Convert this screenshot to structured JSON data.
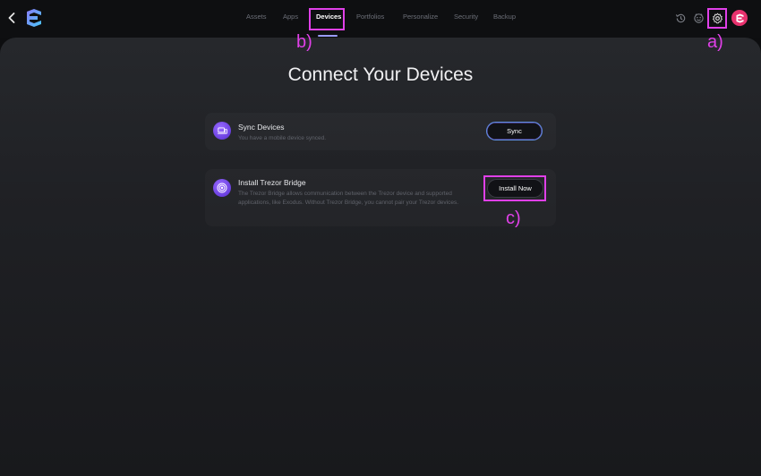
{
  "header": {
    "tabs": [
      {
        "label": "Assets"
      },
      {
        "label": "Apps"
      },
      {
        "label": "Devices",
        "active": true
      },
      {
        "label": "Portfolios"
      },
      {
        "label": "Personalize"
      },
      {
        "label": "Security"
      },
      {
        "label": "Backup"
      }
    ],
    "icons": [
      "back-icon",
      "exodus-logo",
      "history-icon",
      "smiley-icon",
      "gear-icon",
      "avatar"
    ]
  },
  "main": {
    "title": "Connect Your Devices",
    "cards": [
      {
        "title": "Sync Devices",
        "description": "You have a mobile device synced.",
        "button_label": "Sync",
        "icon": "device-icon"
      },
      {
        "title": "Install Trezor Bridge",
        "description": "The Trezor Bridge allows communication between the Trezor device and supported applications, like Exodus. Without Trezor Bridge, you cannot pair your Trezor devices.",
        "button_label": "Install Now",
        "icon": "wireless-icon"
      }
    ]
  },
  "annotations": {
    "a": "a)",
    "b": "b)",
    "c": "c)",
    "color": "#e040e8"
  },
  "colors": {
    "accent": "#9a9cff",
    "avatar": "#e8326e",
    "card_icon": "#7a4cf0"
  }
}
